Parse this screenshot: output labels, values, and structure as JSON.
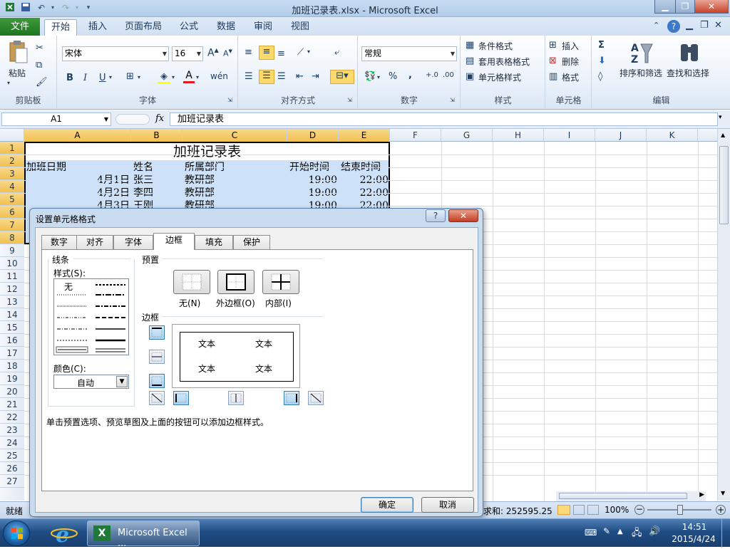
{
  "window": {
    "title": "加班记录表.xlsx  -  Microsoft Excel"
  },
  "ribbon": {
    "file_tab": "文件",
    "tabs": [
      "开始",
      "插入",
      "页面布局",
      "公式",
      "数据",
      "审阅",
      "视图"
    ],
    "clipboard": {
      "paste": "粘贴",
      "label": "剪贴板"
    },
    "font": {
      "name": "宋体",
      "size": "16",
      "label": "字体",
      "bold": "B",
      "italic": "I",
      "underline": "U"
    },
    "alignment": {
      "label": "对齐方式"
    },
    "number": {
      "format": "常规",
      "label": "数字",
      "percent": "%",
      "comma": ","
    },
    "styles": {
      "conditional": "条件格式",
      "table": "套用表格格式",
      "cell": "单元格样式",
      "label": "样式"
    },
    "cells": {
      "insert": "插入",
      "delete": "删除",
      "format": "格式",
      "label": "单元格"
    },
    "editing": {
      "sort": "排序和筛选",
      "find": "查找和选择",
      "label": "编辑",
      "sum": "Σ"
    }
  },
  "formula_bar": {
    "name_box": "A1",
    "fx": "fx",
    "content": "加班记录表"
  },
  "grid": {
    "columns": [
      "A",
      "B",
      "C",
      "D",
      "E",
      "F",
      "G",
      "H",
      "I",
      "J",
      "K"
    ],
    "rows": [
      "1",
      "2",
      "3",
      "4",
      "5",
      "6",
      "7",
      "8",
      "9",
      "10",
      "11",
      "12",
      "13",
      "14",
      "15",
      "16",
      "17",
      "18",
      "19",
      "20",
      "21",
      "22",
      "23",
      "24",
      "25",
      "26",
      "27"
    ],
    "title": "加班记录表",
    "headers": [
      "加班日期",
      "姓名",
      "所属部门",
      "开始时间",
      "结束时间"
    ],
    "data": [
      [
        "4月1日",
        "张三",
        "教研部",
        "19:00",
        "22:00"
      ],
      [
        "4月2日",
        "李四",
        "教研部",
        "19:00",
        "22:00"
      ],
      [
        "4月3日",
        "王刚",
        "教研部",
        "19:00",
        "22:00"
      ]
    ]
  },
  "dialog": {
    "title": "设置单元格格式",
    "help": "?",
    "tabs": [
      "数字",
      "对齐",
      "字体",
      "边框",
      "填充",
      "保护"
    ],
    "line_group": "线条",
    "style_label": "样式(S):",
    "style_none": "无",
    "color_label": "颜色(C):",
    "color_value": "自动",
    "presets_group": "预置",
    "preset_none": "无(N)",
    "preset_outline": "外边框(O)",
    "preset_inside": "内部(I)",
    "border_group": "边框",
    "preview_text": [
      "文本",
      "文本",
      "文本",
      "文本"
    ],
    "hint": "单击预置选项、预览草图及上面的按钮可以添加边框样式。",
    "ok": "确定",
    "cancel": "取消"
  },
  "status": {
    "ready": "就绪",
    "sum": "求和: 252595.25",
    "zoom": "100%"
  },
  "taskbar": {
    "app": "Microsoft Excel ...",
    "time": "14:51",
    "date": "2015/4/24"
  }
}
